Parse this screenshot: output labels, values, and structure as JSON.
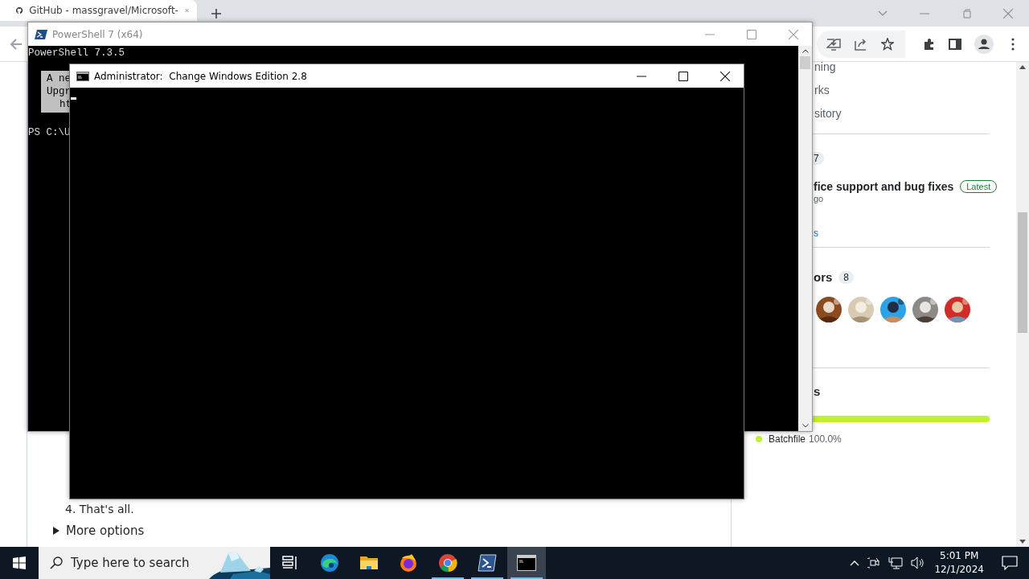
{
  "browser": {
    "tabs": [
      {
        "title": "GitHub - massgravel/Microsoft-",
        "selected": true
      }
    ]
  },
  "article": {
    "items": [
      {
        "kind": "step",
        "text": "4. That's all."
      },
      {
        "kind": "details",
        "text": "More options",
        "expanded": false
      }
    ]
  },
  "sidebar": {
    "about_links": [
      "ning",
      "rks",
      "sitory"
    ],
    "releases": {
      "count": "7",
      "latest_title": "fice support and bug fixes",
      "badge": "Latest",
      "date": "go",
      "more_link": "s"
    },
    "contributors": {
      "heading": "ors",
      "count": "8"
    },
    "languages": {
      "heading": "s",
      "items": [
        {
          "name": "Batchfile",
          "percent": "100.0%",
          "color": "#c1f12e",
          "level": 1
        }
      ]
    }
  },
  "windows": [
    {
      "kind": "powershell",
      "title": "PowerShell 7 (x64)",
      "active": false,
      "header": "PowerShell 7.3.5",
      "notice_lines": [
        "A ne",
        "Upgr",
        "ht"
      ],
      "prompt": "PS C:\\U"
    },
    {
      "kind": "console",
      "title": "Administrator:  Change Windows Edition 2.8",
      "active": true
    }
  ],
  "taskbar": {
    "search_placeholder": "Type here to search",
    "apps": [
      {
        "kind": "task-view",
        "running": false,
        "selected": false
      },
      {
        "kind": "edge",
        "running": false,
        "selected": false
      },
      {
        "kind": "explorer",
        "running": false,
        "selected": false
      },
      {
        "kind": "firefox",
        "running": false,
        "selected": false
      },
      {
        "kind": "chrome",
        "running": true,
        "selected": false
      },
      {
        "kind": "powershell",
        "running": true,
        "selected": false
      },
      {
        "kind": "console",
        "running": true,
        "selected": true
      }
    ],
    "time": "5:01 PM",
    "date": "12/1/2024"
  }
}
